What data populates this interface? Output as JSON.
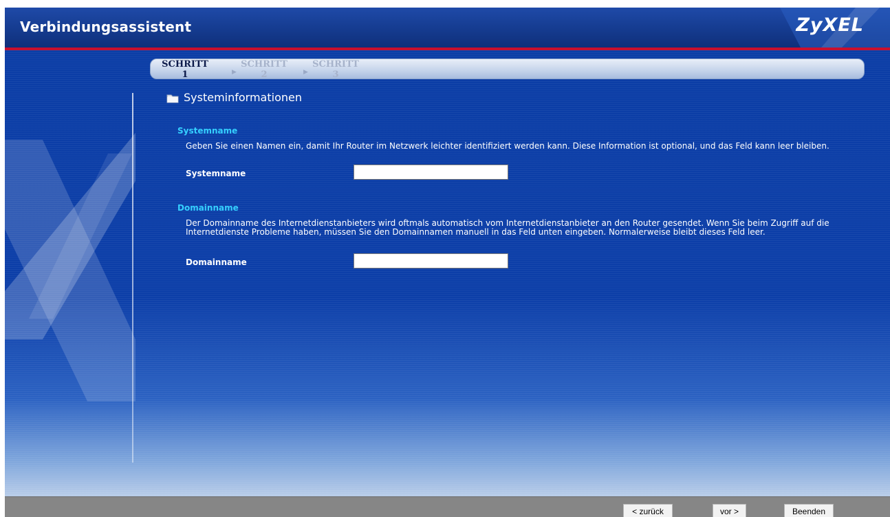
{
  "header": {
    "title": "Verbindungsassistent",
    "logo": "ZyXEL"
  },
  "steps": [
    {
      "label": "SCHRITT",
      "number": "1",
      "active": true
    },
    {
      "label": "SCHRITT",
      "number": "2",
      "active": false
    },
    {
      "label": "SCHRITT",
      "number": "3",
      "active": false
    }
  ],
  "section": {
    "title": "Systeminformationen",
    "icon": "folder-icon"
  },
  "systemname": {
    "heading": "Systemname",
    "description": "Geben Sie einen Namen ein, damit Ihr Router im Netzwerk leichter identifiziert werden kann. Diese Information ist optional, und das Feld kann leer bleiben.",
    "label": "Systemname",
    "value": ""
  },
  "domainname": {
    "heading": "Domainname",
    "description": "Der Domainname des Internetdienstanbieters wird oftmals automatisch vom Internetdienstanbieter an den Router gesendet. Wenn Sie beim Zugriff auf die Internetdienste Probleme haben, müssen Sie den Domainnamen manuell in das Feld unten eingeben. Normalerweise bleibt dieses Feld leer.",
    "label": "Domainname",
    "value": ""
  },
  "footer": {
    "back_label": "< zurück",
    "next_label": "vor >",
    "finish_label": "Beenden"
  },
  "colors": {
    "header_blue": "#153b8f",
    "accent_red": "#c8102e",
    "group_heading_cyan": "#35d0ff",
    "main_blue": "#0c3ea8"
  }
}
